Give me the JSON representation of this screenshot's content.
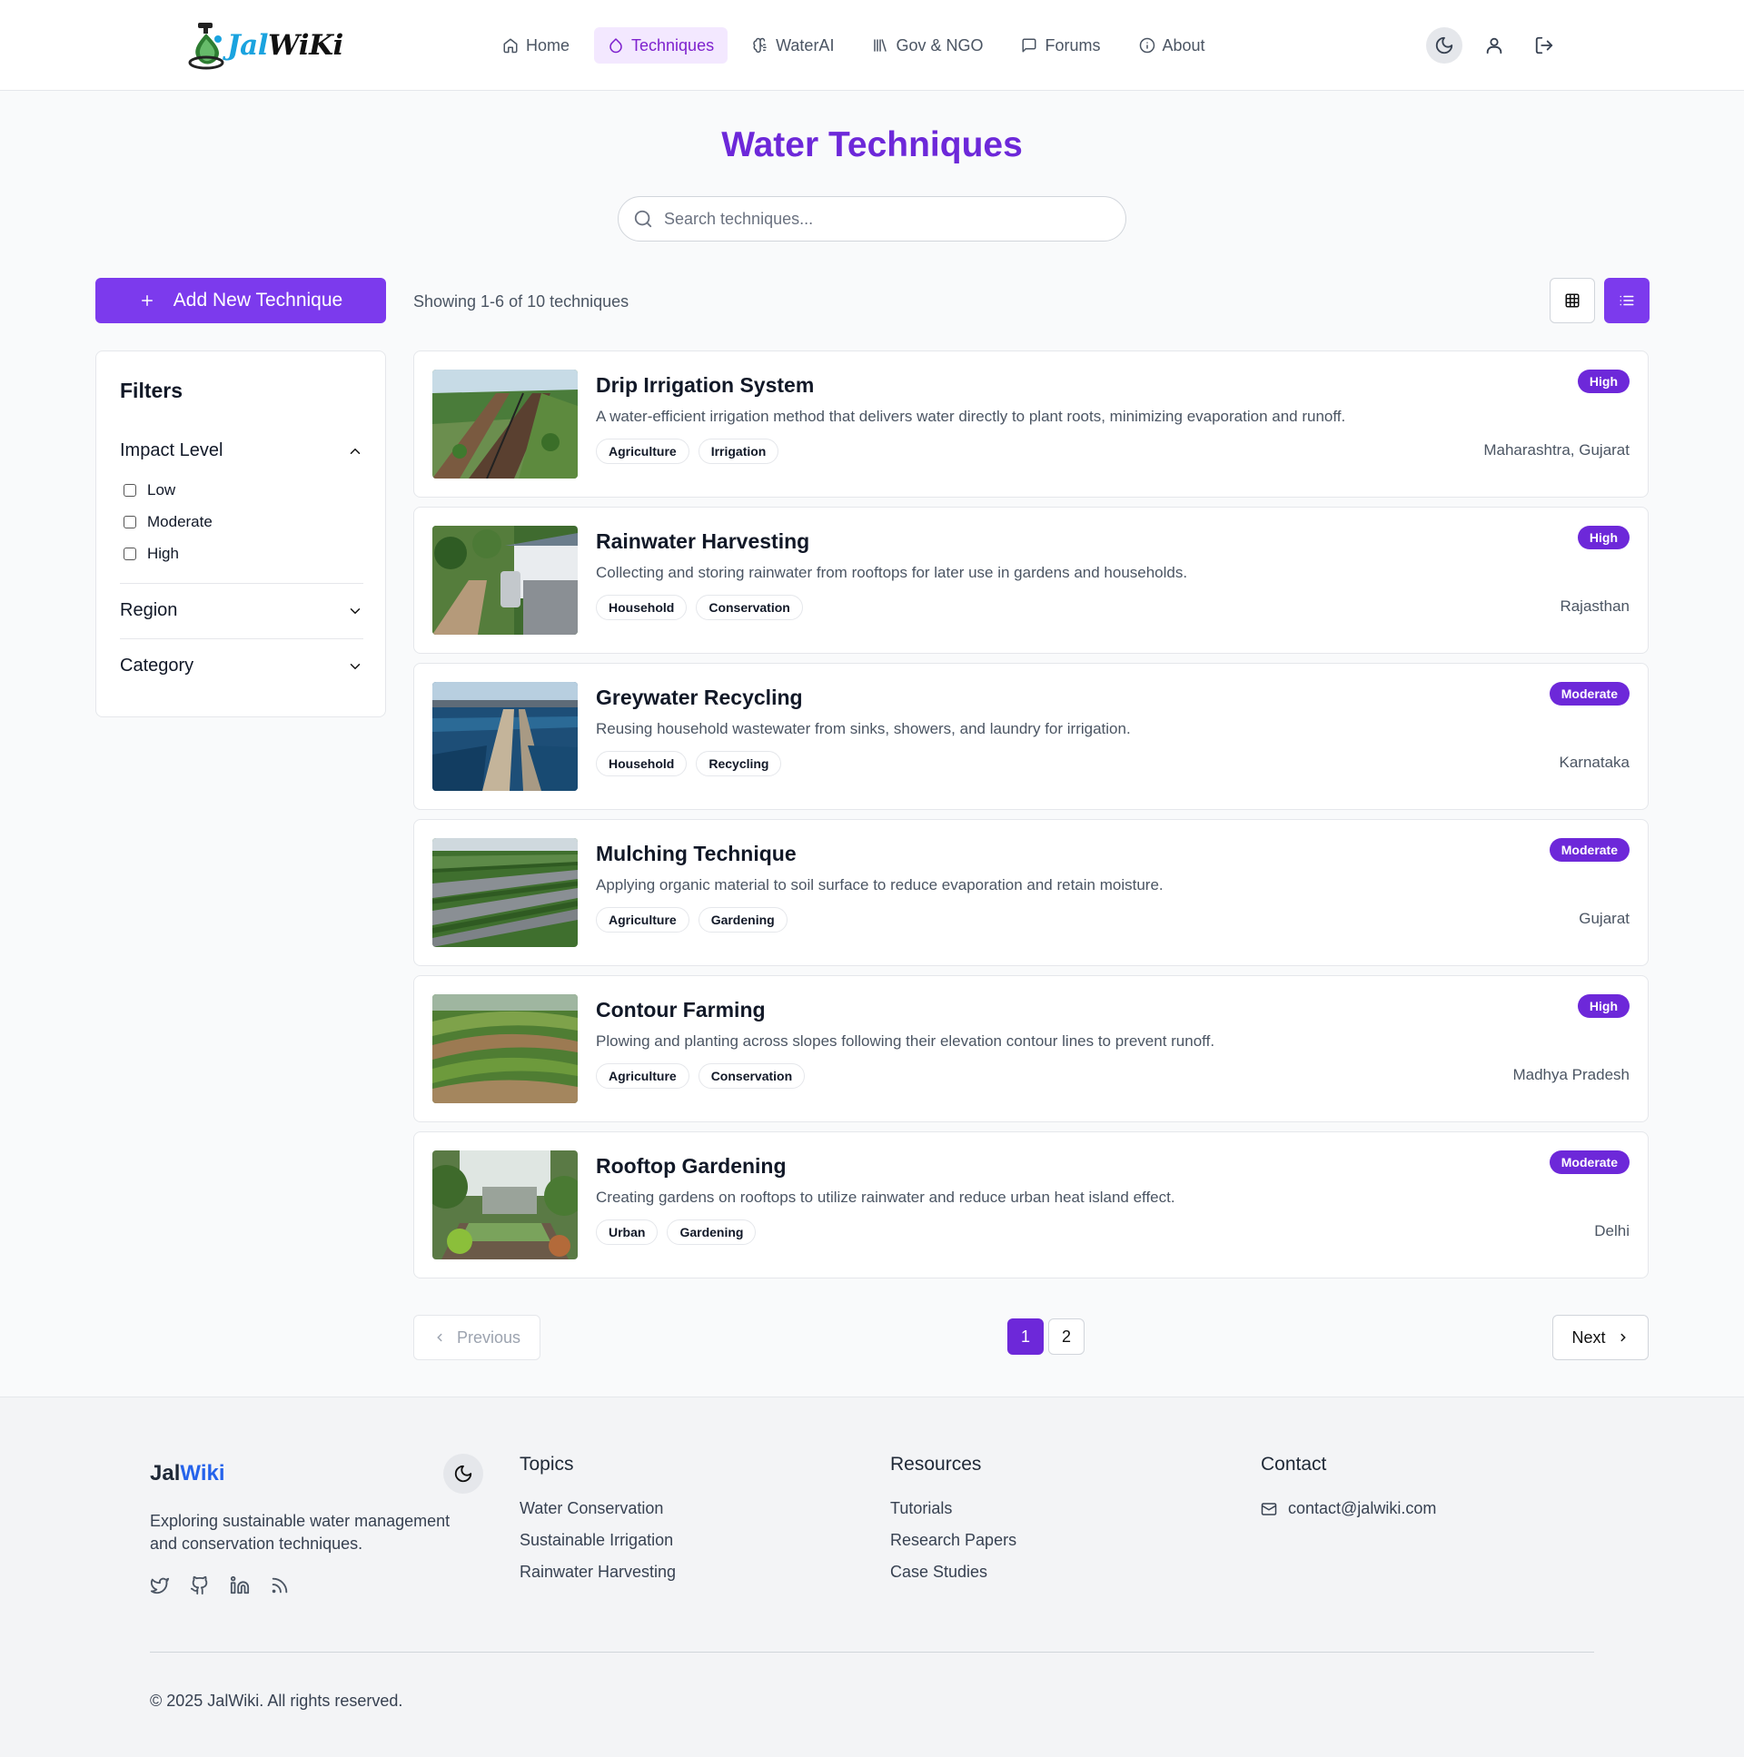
{
  "brand": {
    "name_part1": "Jal",
    "name_part2": "WiKi"
  },
  "nav": [
    {
      "label": "Home",
      "icon": "home-icon"
    },
    {
      "label": "Techniques",
      "icon": "droplet-icon",
      "active": true
    },
    {
      "label": "WaterAI",
      "icon": "brain-icon"
    },
    {
      "label": "Gov & NGO",
      "icon": "library-icon"
    },
    {
      "label": "Forums",
      "icon": "message-square-icon"
    },
    {
      "label": "About",
      "icon": "info-icon"
    }
  ],
  "header_actions": [
    "moon-icon",
    "user-icon",
    "logout-icon"
  ],
  "page": {
    "title": "Water Techniques",
    "search_placeholder": "Search techniques...",
    "add_button": "Add New Technique",
    "showing": "Showing 1-6 of 10 techniques"
  },
  "filters": {
    "title": "Filters",
    "impact_level": {
      "label": "Impact Level",
      "options": [
        "Low",
        "Moderate",
        "High"
      ]
    },
    "region": {
      "label": "Region"
    },
    "category": {
      "label": "Category"
    }
  },
  "techniques": [
    {
      "title": "Drip Irrigation System",
      "description": "A water-efficient irrigation method that delivers water directly to plant roots, minimizing evaporation and runoff.",
      "tags": [
        "Agriculture",
        "Irrigation"
      ],
      "impact": "High",
      "region": "Maharashtra, Gujarat"
    },
    {
      "title": "Rainwater Harvesting",
      "description": "Collecting and storing rainwater from rooftops for later use in gardens and households.",
      "tags": [
        "Household",
        "Conservation"
      ],
      "impact": "High",
      "region": "Rajasthan"
    },
    {
      "title": "Greywater Recycling",
      "description": "Reusing household wastewater from sinks, showers, and laundry for irrigation.",
      "tags": [
        "Household",
        "Recycling"
      ],
      "impact": "Moderate",
      "region": "Karnataka"
    },
    {
      "title": "Mulching Technique",
      "description": "Applying organic material to soil surface to reduce evaporation and retain moisture.",
      "tags": [
        "Agriculture",
        "Gardening"
      ],
      "impact": "Moderate",
      "region": "Gujarat"
    },
    {
      "title": "Contour Farming",
      "description": "Plowing and planting across slopes following their elevation contour lines to prevent runoff.",
      "tags": [
        "Agriculture",
        "Conservation"
      ],
      "impact": "High",
      "region": "Madhya Pradesh"
    },
    {
      "title": "Rooftop Gardening",
      "description": "Creating gardens on rooftops to utilize rainwater and reduce urban heat island effect.",
      "tags": [
        "Urban",
        "Gardening"
      ],
      "impact": "Moderate",
      "region": "Delhi"
    }
  ],
  "pagination": {
    "previous": "Previous",
    "next": "Next",
    "pages": [
      "1",
      "2"
    ],
    "current": "1"
  },
  "footer": {
    "brand_part1": "Jal",
    "brand_part2": "Wiki",
    "about": "Exploring sustainable water management and conservation techniques.",
    "social": [
      "twitter-icon",
      "github-icon",
      "linkedin-icon",
      "rss-icon"
    ],
    "topics": {
      "heading": "Topics",
      "links": [
        "Water Conservation",
        "Sustainable Irrigation",
        "Rainwater Harvesting"
      ]
    },
    "resources": {
      "heading": "Resources",
      "links": [
        "Tutorials",
        "Research Papers",
        "Case Studies"
      ]
    },
    "contact": {
      "heading": "Contact",
      "email": "contact@jalwiki.com"
    },
    "copyright": "© 2025 JalWiki. All rights reserved."
  },
  "colors": {
    "accent": "#7c3aed",
    "accent_dark": "#6d28d9",
    "active_nav_bg": "#f3e8ff"
  }
}
